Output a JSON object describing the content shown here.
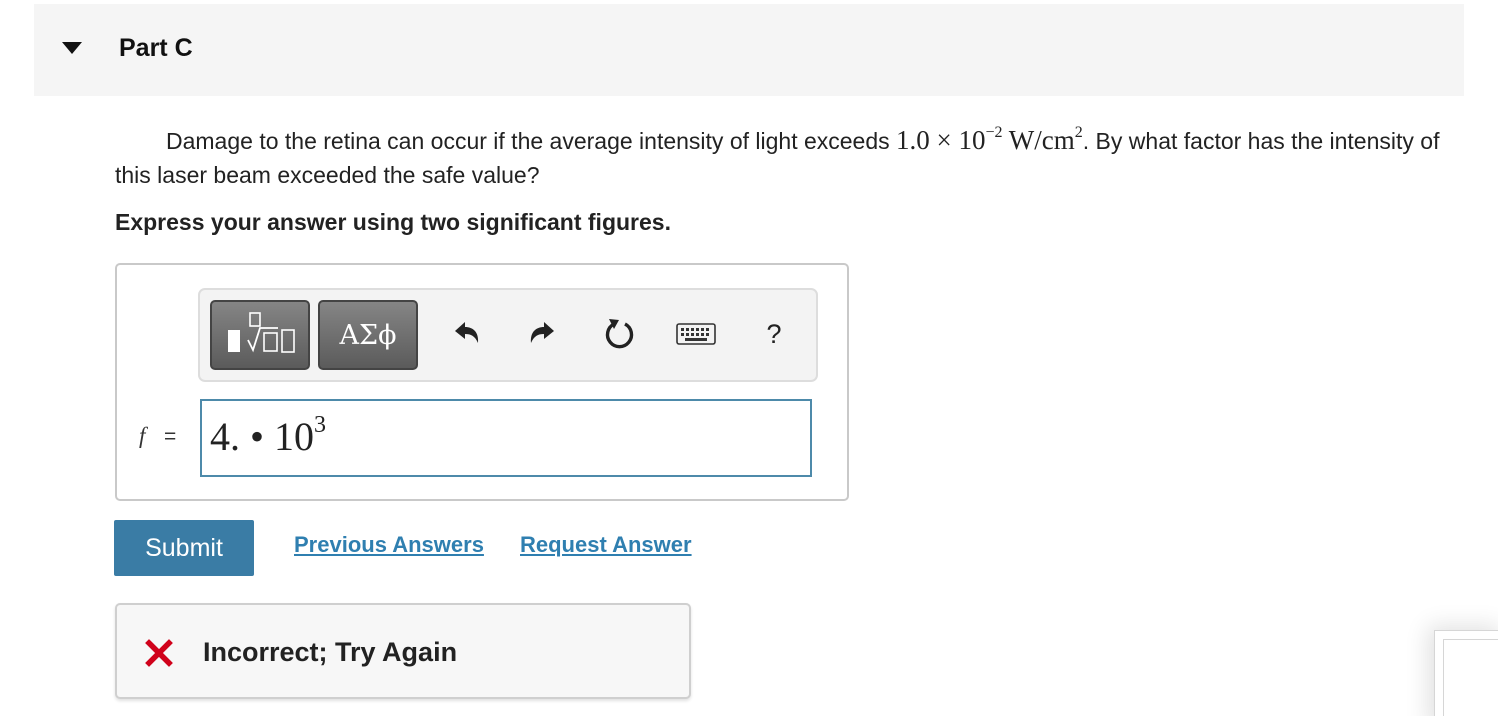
{
  "part": {
    "title": "Part C"
  },
  "question": {
    "text_before": "Damage to the retina can occur if the average intensity of light exceeds ",
    "math_mantissa": "1.0 × 10",
    "math_exponent": "−2",
    "math_unit": " W/cm",
    "math_unit_exponent": "2",
    "text_after": ". By what factor has the intensity of this laser beam exceeded the safe value?"
  },
  "instruction": "Express your answer using two significant figures.",
  "toolbar": {
    "greek_label": "ΑΣϕ",
    "help_label": "?",
    "icons": [
      "templates-icon",
      "undo-icon",
      "redo-icon",
      "reset-icon",
      "keyboard-icon",
      "help-icon"
    ]
  },
  "answer": {
    "variable": "f",
    "equals": "=",
    "value_base": "4. • 10",
    "value_exponent": "3"
  },
  "actions": {
    "submit_label": "Submit",
    "previous_answers_label": "Previous Answers",
    "request_answer_label": "Request Answer"
  },
  "feedback": {
    "text": "Incorrect; Try Again",
    "status_color": "#d0021b"
  },
  "colors": {
    "accent": "#3a7ca5",
    "link": "#2f7fb0",
    "input_border": "#4d8aaa"
  }
}
